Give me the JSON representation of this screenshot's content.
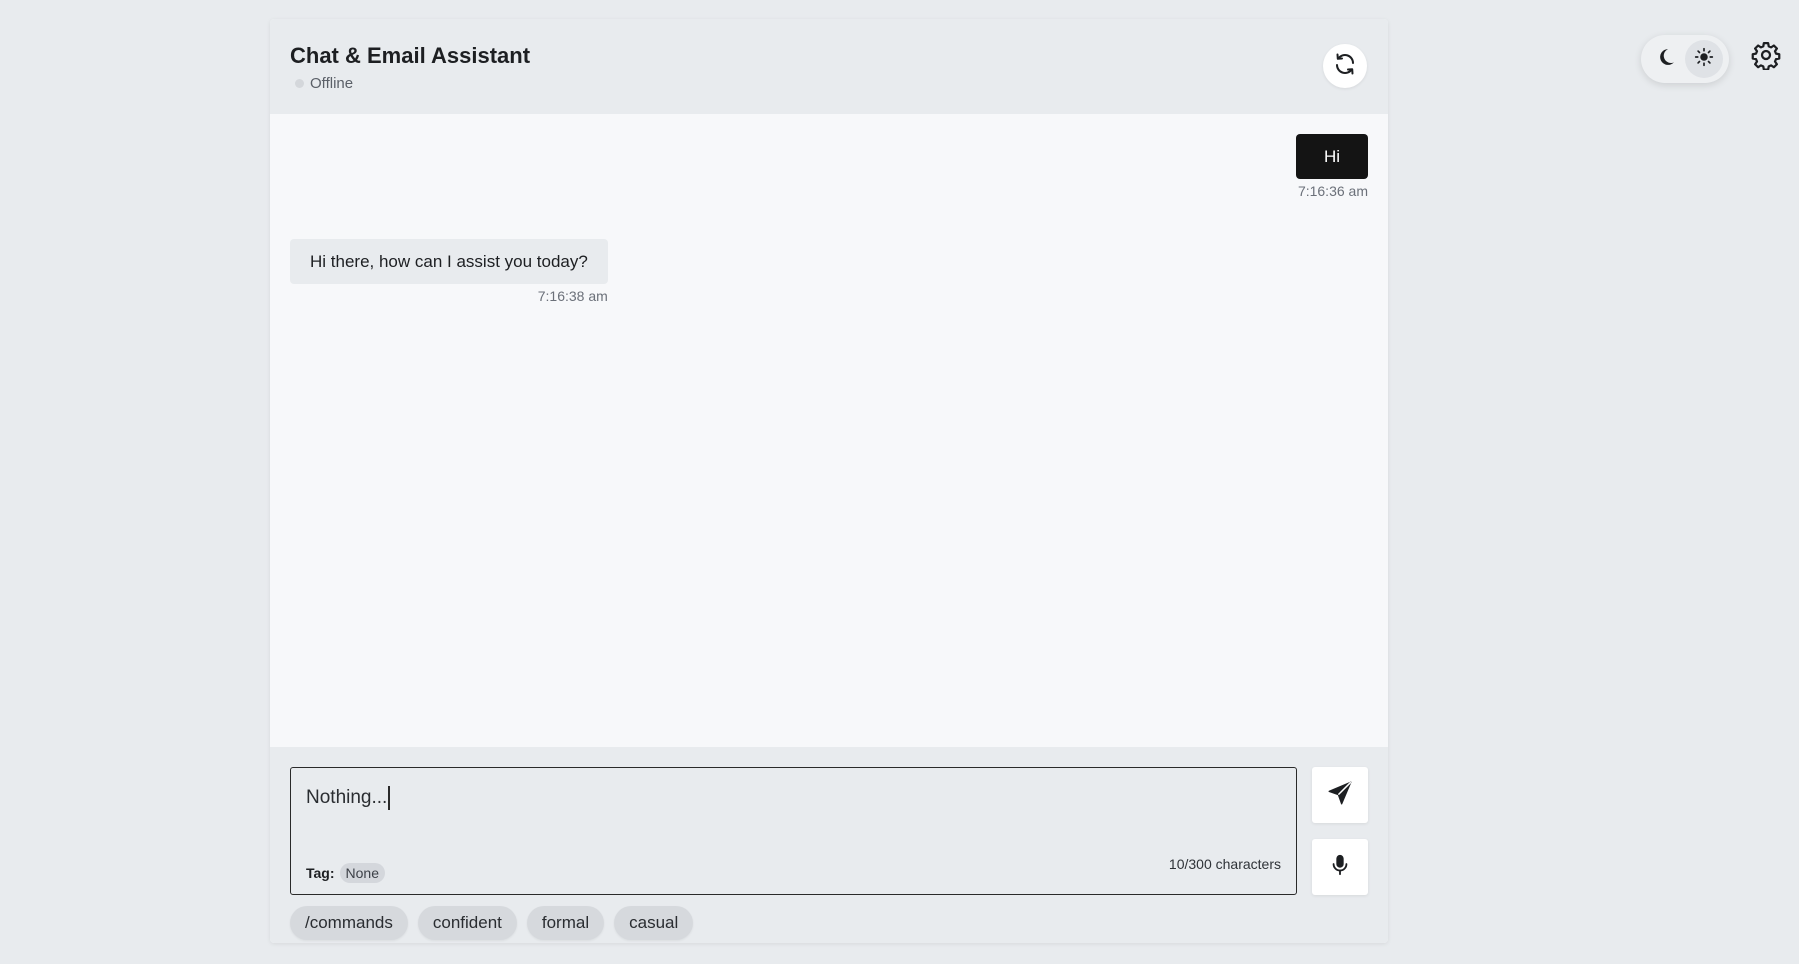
{
  "header": {
    "title": "Chat & Email Assistant",
    "status": "Offline",
    "refresh_icon": "refresh-icon"
  },
  "theme": {
    "dark_icon": "moon-icon",
    "light_icon": "sun-icon",
    "active": "light",
    "settings_icon": "gear-icon"
  },
  "messages": [
    {
      "role": "user",
      "text": "Hi",
      "time": "7:16:36 am"
    },
    {
      "role": "assistant",
      "text": "Hi there, how can I assist you today?",
      "time": "7:16:38 am"
    }
  ],
  "composer": {
    "value": "Nothing...",
    "tag_label": "Tag:",
    "tag_value": "None",
    "char_count": "10/300 characters",
    "send_icon": "send-icon",
    "mic_icon": "microphone-icon"
  },
  "chips": [
    "/commands",
    "confident",
    "formal",
    "casual"
  ],
  "colors": {
    "background": "#e8ebee",
    "panel": "#f7f8fa",
    "user_bubble": "#141414",
    "bot_bubble": "#e8ebee",
    "status_dot": "#d4d7db"
  }
}
